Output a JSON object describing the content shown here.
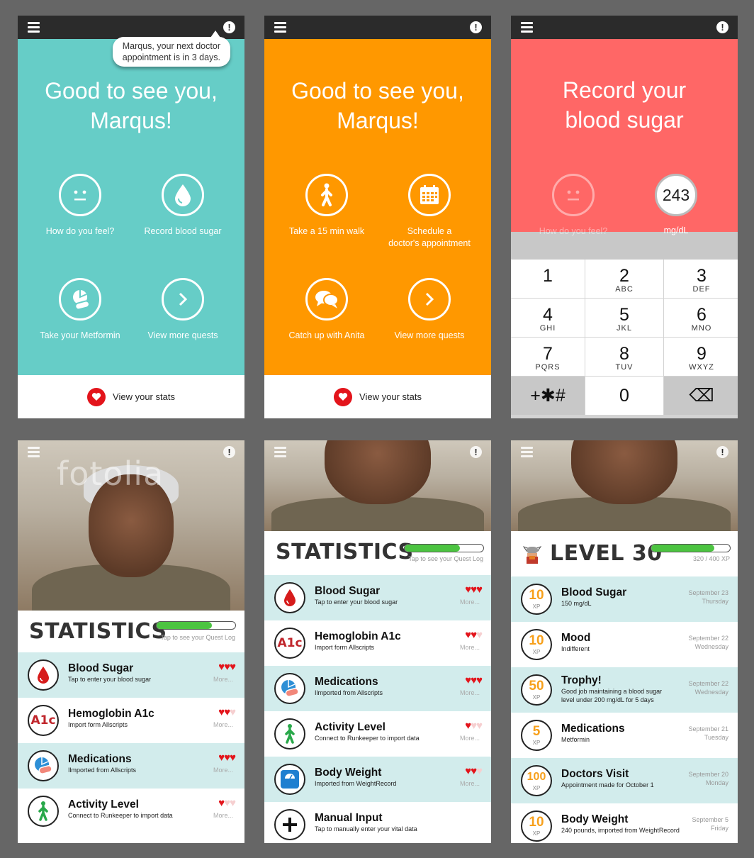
{
  "colors": {
    "teal": "#66cdc7",
    "orange": "#ff9800",
    "coral": "#ff6766",
    "heart": "#e3141b",
    "alt_row": "#d2ecec",
    "xp_gold": "#f7a01b"
  },
  "screen1": {
    "bubble": [
      "Marqus, your next doctor",
      "appointment is in 3 days."
    ],
    "greeting": [
      "Good to see you,",
      "Marqus!"
    ],
    "quests": [
      {
        "icon": "neutral-face-icon",
        "label": [
          "How do you feel?"
        ]
      },
      {
        "icon": "blood-drop-icon",
        "label": [
          "Record blood sugar"
        ]
      },
      {
        "icon": "pills-icon",
        "label": [
          "Take your Metformin"
        ]
      },
      {
        "icon": "chevron-right-icon",
        "label": [
          "View more quests"
        ]
      }
    ],
    "footer": "View your stats"
  },
  "screen2": {
    "greeting": [
      "Good to see you,",
      "Marqus!"
    ],
    "quests": [
      {
        "icon": "walking-person-icon",
        "label": [
          "Take a 15 min walk"
        ]
      },
      {
        "icon": "calendar-icon",
        "label": [
          "Schedule a",
          "doctor's appointment"
        ]
      },
      {
        "icon": "chat-bubbles-icon",
        "label": [
          "Catch up with Anita"
        ]
      },
      {
        "icon": "chevron-right-icon",
        "label": [
          "View more quests"
        ]
      }
    ],
    "footer": "View your stats"
  },
  "screen3": {
    "title": [
      "Record your",
      "blood sugar"
    ],
    "feel_label": "How do you feel?",
    "reading": "243",
    "unit": "mg/dL",
    "keys": [
      {
        "n": "1",
        "l": ""
      },
      {
        "n": "2",
        "l": "ABC"
      },
      {
        "n": "3",
        "l": "DEF"
      },
      {
        "n": "4",
        "l": "GHI"
      },
      {
        "n": "5",
        "l": "JKL"
      },
      {
        "n": "6",
        "l": "MNO"
      },
      {
        "n": "7",
        "l": "PQRS"
      },
      {
        "n": "8",
        "l": "TUV"
      },
      {
        "n": "9",
        "l": "WXYZ"
      },
      {
        "n": "+✱#",
        "l": ""
      },
      {
        "n": "0",
        "l": ""
      },
      {
        "n": "⌫",
        "l": ""
      }
    ]
  },
  "screen4": {
    "watermark": "fotolia",
    "title": "STATISTICS",
    "progress": 0.7,
    "caption": "Tap to see your Quest Log",
    "rows": [
      {
        "icon": "blood-drop-icon",
        "title": "Blood Sugar",
        "sub": "Tap to enter your blood sugar",
        "hearts": 3,
        "more": "More..."
      },
      {
        "icon": "a1c-icon",
        "title": "Hemoglobin A1c",
        "sub": "Import form Allscripts",
        "hearts": 2,
        "more": "More..."
      },
      {
        "icon": "pills-icon",
        "title": "Medications",
        "sub": "Ilmported from Allscripts",
        "hearts": 3,
        "more": "More..."
      },
      {
        "icon": "walking-person-icon",
        "title": "Activity Level",
        "sub": "Connect to Runkeeper to import data",
        "hearts": 1,
        "more": "More..."
      }
    ]
  },
  "screen5": {
    "title": "STATISTICS",
    "progress": 0.7,
    "caption": "Tap to see your Quest Log",
    "rows": [
      {
        "icon": "blood-drop-icon",
        "title": "Blood Sugar",
        "sub": "Tap to enter your blood sugar",
        "hearts": 3,
        "more": "More..."
      },
      {
        "icon": "a1c-icon",
        "title": "Hemoglobin A1c",
        "sub": "Import form Allscripts",
        "hearts": 2,
        "more": "More..."
      },
      {
        "icon": "pills-icon",
        "title": "Medications",
        "sub": "Ilmported from Allscripts",
        "hearts": 3,
        "more": "More..."
      },
      {
        "icon": "walking-person-icon",
        "title": "Activity Level",
        "sub": "Connect to Runkeeper to import data",
        "hearts": 1,
        "more": "More..."
      },
      {
        "icon": "scale-icon",
        "title": "Body Weight",
        "sub": "Imported from WeightRecord",
        "hearts": 2,
        "more": "More..."
      },
      {
        "icon": "plus-icon",
        "title": "Manual Input",
        "sub": "Tap to manually enter your vital data",
        "hearts": 0,
        "more": ""
      }
    ]
  },
  "screen6": {
    "title": "LEVEL 30",
    "progress": 0.8,
    "xp_caption": "320 / 400 XP",
    "rows": [
      {
        "xp": "10",
        "title": "Blood Sugar",
        "sub": [
          "150  mg/dL"
        ],
        "date": [
          "September 23",
          "Thursday"
        ]
      },
      {
        "xp": "10",
        "title": "Mood",
        "sub": [
          "Indifferent"
        ],
        "date": [
          "September 22",
          "Wednesday"
        ]
      },
      {
        "xp": "50",
        "title": "Trophy!",
        "sub": [
          "Good job maintaining a blood sugar",
          "level under 200 mg/dL for 5 days"
        ],
        "date": [
          "September 22",
          "Wednesday"
        ]
      },
      {
        "xp": "5",
        "title": "Medications",
        "sub": [
          "Metformin"
        ],
        "date": [
          "September 21",
          "Tuesday"
        ]
      },
      {
        "xp": "100",
        "title": "Doctors Visit",
        "sub": [
          "Appointment made for October 1"
        ],
        "date": [
          "September 20",
          "Monday"
        ]
      },
      {
        "xp": "10",
        "title": "Body Weight",
        "sub": [
          "240 pounds, imported from WeightRecord"
        ],
        "date": [
          "September 5",
          "Friday"
        ]
      }
    ],
    "xp_unit": "XP"
  }
}
